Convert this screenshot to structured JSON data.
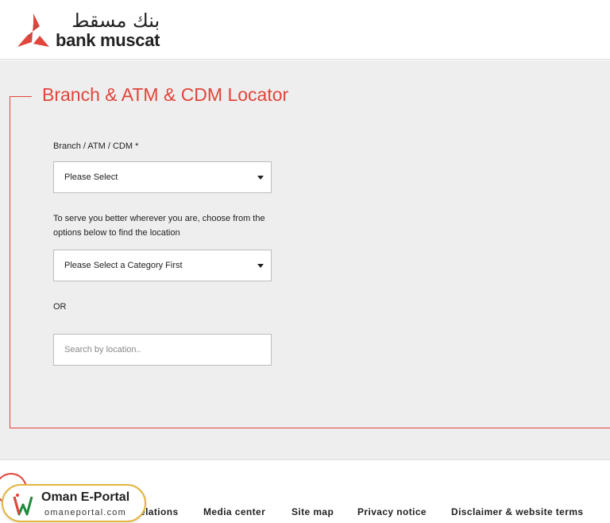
{
  "header": {
    "logo_arabic": "بنك مسقط",
    "logo_english": "bank muscat"
  },
  "locator": {
    "title": "Branch & ATM & CDM Locator",
    "type_label": "Branch / ATM / CDM *",
    "type_select_value": "Please Select",
    "helper_text": "To serve you better wherever you are, choose from the options below to find the location",
    "category_select_value": "Please Select a Category First",
    "or_text": "OR",
    "search_placeholder": "Search by location.."
  },
  "footer": {
    "links": [
      "elations",
      "Media center",
      "Site map",
      "Privacy notice",
      "Disclaimer & website terms"
    ]
  },
  "badge": {
    "title": "Oman E-Portal",
    "subtitle": "omaneportal.com"
  },
  "colors": {
    "accent": "#e2453b",
    "background": "#eeeeee",
    "badge_border": "#e3b640"
  },
  "icons": {
    "logo": "bank-muscat-logo-icon",
    "caret": "caret-down-icon",
    "badge": "oman-eportal-logo-icon"
  }
}
